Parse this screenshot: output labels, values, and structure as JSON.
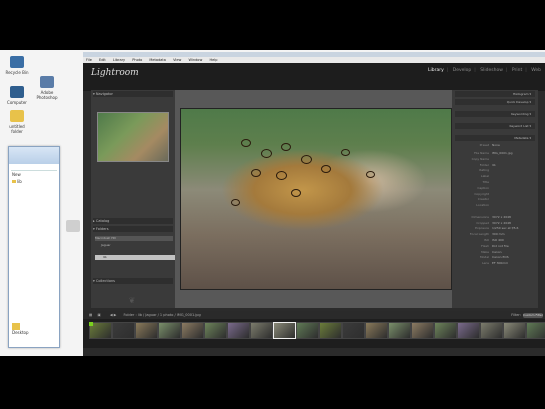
{
  "desktop": {
    "icons": [
      {
        "label": "Recycle Bin",
        "icon": "recycle-bin-icon",
        "color": "#3a6ea5"
      },
      {
        "label": "Computer",
        "icon": "computer-icon",
        "color": "#2f5e8e"
      },
      {
        "label": "Adobe Photoshop",
        "icon": "photoshop-icon",
        "color": "#5a7ca8"
      },
      {
        "label": "untitled folder",
        "icon": "folder-icon",
        "color": "#e8c24a"
      },
      {
        "label": "",
        "icon": "file-icon",
        "color": "#cfcfcf"
      }
    ]
  },
  "explorer": {
    "items": [
      "New",
      "lib",
      "Desktop"
    ]
  },
  "lightroom": {
    "logo": "Lightroom",
    "menu": [
      "File",
      "Edit",
      "Library",
      "Photo",
      "Metadata",
      "View",
      "Window",
      "Help"
    ],
    "modules": [
      "Library",
      "Develop",
      "Slideshow",
      "Print",
      "Web"
    ],
    "active_module": "Library",
    "left_panel": {
      "navigator": "Navigator",
      "catalog": "Catalog",
      "folders": "Folders",
      "folder_rows": [
        "Macintosh HD",
        "Jaguar",
        "",
        "lib",
        "",
        ""
      ],
      "collections": "Collections",
      "import_btn": "Import...",
      "export_btn": "Export..."
    },
    "right_panel": {
      "histogram": "Histogram",
      "saved_preset": "Quick Develop",
      "keywording": "Keywording",
      "keyword_list": "Keyword List",
      "metadata": "Metadata",
      "preset_label": "Preset",
      "preset_value": "None",
      "meta_rows": [
        {
          "k": "File Name",
          "v": "IMG_0001.jpg"
        },
        {
          "k": "Copy Name",
          "v": ""
        },
        {
          "k": "Folder",
          "v": "lib"
        },
        {
          "k": "Rating",
          "v": ""
        },
        {
          "k": "Label",
          "v": ""
        },
        {
          "k": "Title",
          "v": ""
        },
        {
          "k": "Caption",
          "v": ""
        },
        {
          "k": "Copyright",
          "v": ""
        },
        {
          "k": "Creator",
          "v": ""
        },
        {
          "k": "Location",
          "v": ""
        },
        {
          "k": "",
          "v": ""
        },
        {
          "k": "Dimensions",
          "v": "3072 x 2048"
        },
        {
          "k": "Cropped",
          "v": "3072 x 2048"
        },
        {
          "k": "Exposure",
          "v": "1/250 sec at f/5.6"
        },
        {
          "k": "Focal Length",
          "v": "300 mm"
        },
        {
          "k": "ISO",
          "v": "ISO 400"
        },
        {
          "k": "Flash",
          "v": "Did not fire"
        },
        {
          "k": "Make",
          "v": "Canon"
        },
        {
          "k": "Model",
          "v": "Canon EOS"
        },
        {
          "k": "Lens",
          "v": "EF 300mm"
        }
      ],
      "sync_btn": "Sync Metadata",
      "sync_settings_btn": "Sync Settings"
    },
    "toolbar": {
      "path": "Folder : lib / Jaguar / 1 photo / IMG_0001.jpg",
      "filter_label": "Filter:",
      "filter_value": "Custom Filter"
    },
    "filmstrip": {
      "count": 20
    }
  }
}
